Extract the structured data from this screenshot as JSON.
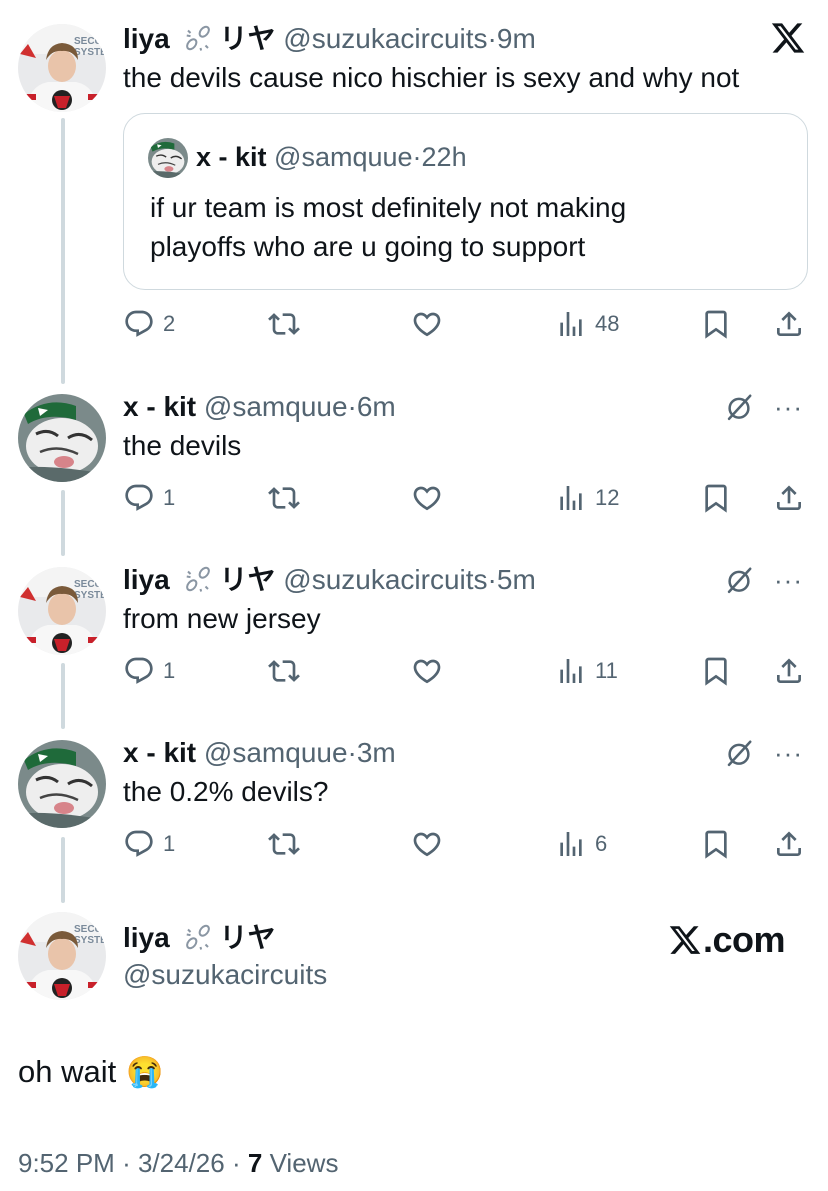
{
  "posts": [
    {
      "name": "liya",
      "name_suffix": "リヤ",
      "handle": "@suzukacircuits",
      "sep": "·",
      "time": "9m",
      "text": "the devils cause nico hischier is sexy and why not",
      "quote": {
        "name": "x - kit",
        "handle": "@samquue",
        "sep": "·",
        "time": "22h",
        "text_line1": "if ur team is most definitely not making",
        "text_line2": "playoffs who are u going to support"
      },
      "stats": {
        "replies": "2",
        "views": "48"
      }
    },
    {
      "name": "x - kit",
      "handle": "@samquue",
      "sep": "·",
      "time": "6m",
      "text": "the devils",
      "stats": {
        "replies": "1",
        "views": "12"
      }
    },
    {
      "name": "liya",
      "name_suffix": "リヤ",
      "handle": "@suzukacircuits",
      "sep": "·",
      "time": "5m",
      "text": "from new jersey",
      "stats": {
        "replies": "1",
        "views": "11"
      }
    },
    {
      "name": "x - kit",
      "handle": "@samquue",
      "sep": "·",
      "time": "3m",
      "text": "the 0.2% devils?",
      "stats": {
        "replies": "1",
        "views": "6"
      }
    }
  ],
  "main": {
    "name": "liya",
    "name_suffix": "リヤ",
    "handle": "@suzukacircuits",
    "brand": ".com",
    "text": "oh wait",
    "emoji": "😭",
    "time": "9:52 PM",
    "sep1": "·",
    "date": "3/24/26",
    "sep2": "·",
    "views_count": "7",
    "views_label": "Views"
  },
  "more_glyph": "···",
  "icons": [
    "x-logo-icon",
    "reply-icon",
    "repost-icon",
    "like-icon",
    "views-icon",
    "bookmark-icon",
    "share-icon",
    "mute-icon",
    "more-icon",
    "link-emoji-icon",
    "crying-emoji-icon"
  ],
  "colors": {
    "text": "#0f1419",
    "secondary": "#536471",
    "border": "#cfd9de"
  }
}
